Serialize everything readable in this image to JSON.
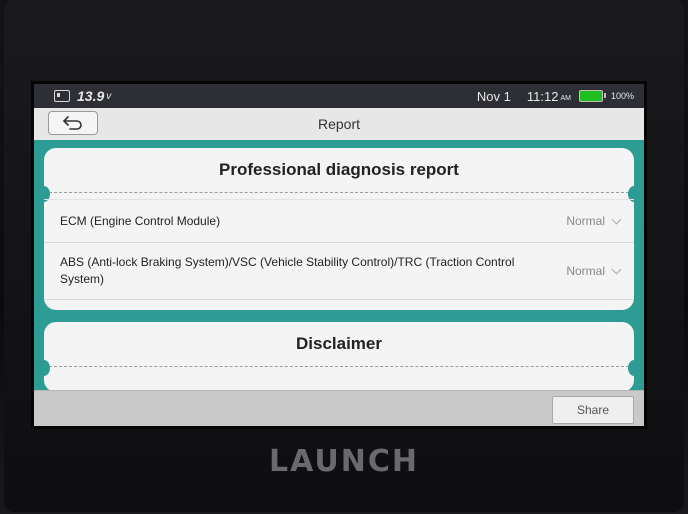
{
  "device": {
    "brand": "LAUNCH"
  },
  "status_bar": {
    "voltage": "13.9",
    "voltage_unit": "v",
    "date": "Nov 1",
    "time": "11:12",
    "ampm": "AM",
    "battery_percent": "100%",
    "battery_color": "#1ec01e"
  },
  "header": {
    "back_icon": "back-arrow-icon",
    "title": "Report"
  },
  "report": {
    "title": "Professional diagnosis report",
    "rows": [
      {
        "name": "ECM (Engine Control Module)",
        "status": "Normal"
      },
      {
        "name": "ABS (Anti-lock Braking System)/VSC (Vehicle Stability Control)/TRC (Traction Control System)",
        "status": "Normal"
      }
    ]
  },
  "disclaimer": {
    "title": "Disclaimer"
  },
  "footer": {
    "share_label": "Share"
  },
  "colors": {
    "accent": "#2c9c94"
  }
}
